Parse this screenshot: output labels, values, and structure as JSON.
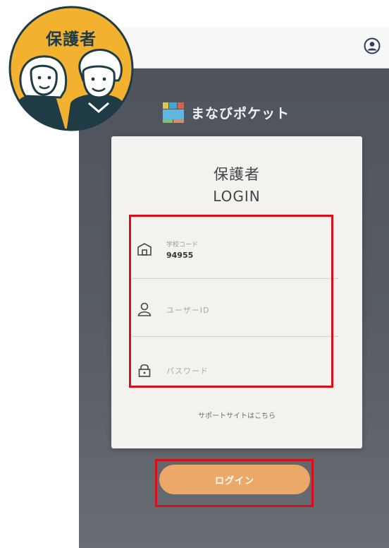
{
  "badge": {
    "label": "保護者"
  },
  "app": {
    "logo_text": "まなびポケット"
  },
  "card": {
    "title_jp": "保護者",
    "title_en": "LOGIN",
    "school_code": {
      "label": "学校コード",
      "value": "94955"
    },
    "user_id": {
      "placeholder": "ユーザーID"
    },
    "password": {
      "placeholder": "パスワード"
    },
    "support_link": "サポートサイトはこちら"
  },
  "login_button": {
    "label": "ログイン"
  },
  "colors": {
    "highlight": "#d80f1a",
    "login_button": "#eca869",
    "badge_bg": "#f2b230",
    "badge_navy": "#1e3b46"
  }
}
